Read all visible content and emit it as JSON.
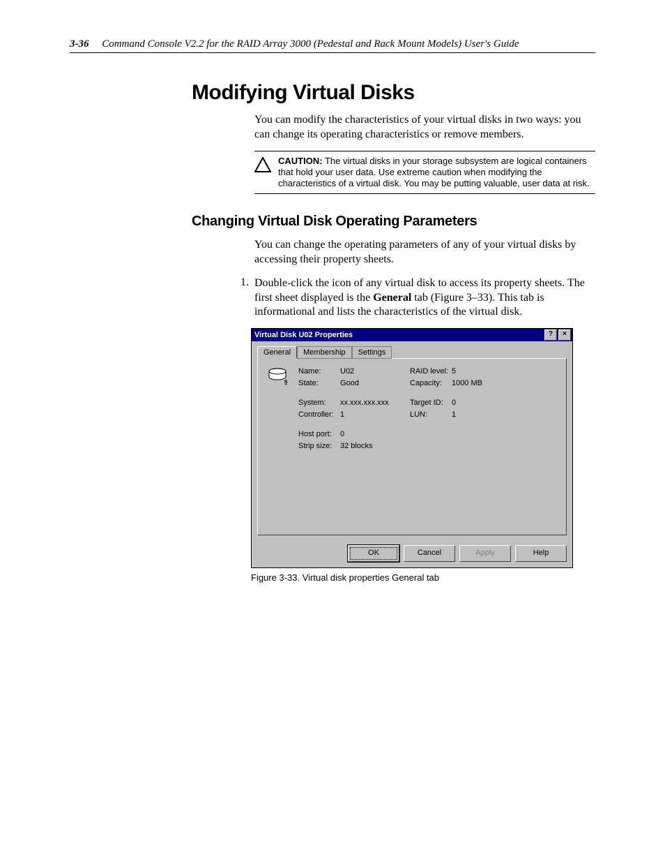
{
  "header": {
    "page_number": "3-36",
    "title": "Command Console V2.2 for the RAID Array 3000 (Pedestal and Rack Mount Models) User's Guide"
  },
  "h1": "Modifying Virtual Disks",
  "intro_p": "You can modify the characteristics of your virtual disks in two ways: you can change its operating characteristics or remove members.",
  "caution": {
    "label": "CAUTION:",
    "text": "The virtual disks in your storage subsystem are logical containers that hold your user data. Use extreme caution when modifying the characteristics of a virtual disk. You may be putting valuable, user data at risk."
  },
  "h2": "Changing Virtual Disk Operating Parameters",
  "p2": "You can change the operating parameters of any of your virtual disks by accessing their property sheets.",
  "step1": {
    "num": "1.",
    "text_1": "Double-click the icon of any virtual disk to access its property sheets. The first sheet displayed is the ",
    "bold": "General",
    "text_2": " tab (Figure 3–33). This tab is informational and lists the characteristics of the virtual disk."
  },
  "dialog": {
    "title": "Virtual Disk U02 Properties",
    "help_btn": "?",
    "close_btn": "×",
    "tabs": {
      "general": "General",
      "membership": "Membership",
      "settings": "Settings"
    },
    "icon_badge": "5",
    "fields": {
      "name_lbl": "Name:",
      "name_val": "U02",
      "state_lbl": "State:",
      "state_val": "Good",
      "raid_lbl": "RAID level:",
      "raid_val": "5",
      "capacity_lbl": "Capacity:",
      "capacity_val": "1000 MB",
      "system_lbl": "System:",
      "system_val": "xx.xxx.xxx.xxx",
      "controller_lbl": "Controller:",
      "controller_val": "1",
      "target_lbl": "Target ID:",
      "target_val": "0",
      "lun_lbl": "LUN:",
      "lun_val": "1",
      "hostport_lbl": "Host port:",
      "hostport_val": "0",
      "strip_lbl": "Strip size:",
      "strip_val": "32 blocks"
    },
    "buttons": {
      "ok": "OK",
      "cancel": "Cancel",
      "apply": "Apply",
      "help": "Help"
    }
  },
  "figure_caption": "Figure 3-33.  Virtual disk properties General tab"
}
